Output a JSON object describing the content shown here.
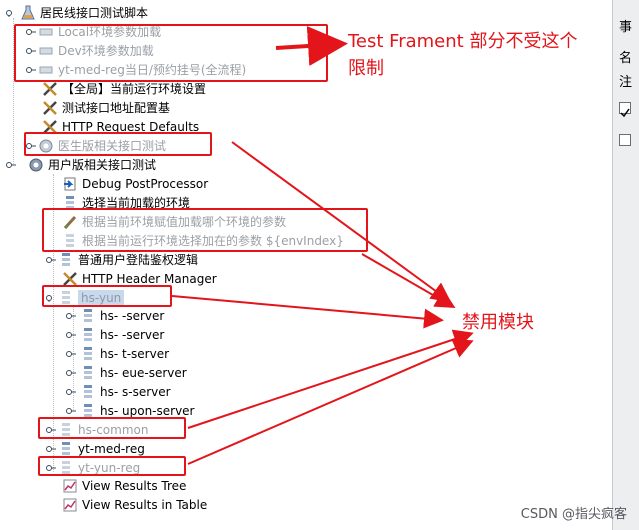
{
  "tree": {
    "root": "居民线接口测试脚本",
    "items": [
      {
        "key": "local",
        "label": "Local环境参数加载",
        "disabled": true
      },
      {
        "key": "dev",
        "label": "Dev环境参数加载",
        "disabled": true
      },
      {
        "key": "ytmed_full",
        "label": "yt-med-reg当日/预约挂号(全流程)",
        "disabled": true
      },
      {
        "key": "global_env",
        "label": "【全局】当前运行环境设置",
        "disabled": false
      },
      {
        "key": "addr_config",
        "label": "测试接口地址配置基",
        "disabled": false
      },
      {
        "key": "http_defaults",
        "label": "HTTP Request Defaults",
        "disabled": false
      },
      {
        "key": "doctor",
        "label": "医生版相关接口测试",
        "disabled": true
      },
      {
        "key": "user",
        "label": "用户版相关接口测试",
        "disabled": false
      },
      {
        "key": "debug_pp",
        "label": "Debug PostProcessor",
        "disabled": false
      },
      {
        "key": "select_env",
        "label": "选择当前加载的环境",
        "disabled": false
      },
      {
        "key": "env_assign",
        "label": "根据当前环境赋值加载哪个环境的参数",
        "disabled": true
      },
      {
        "key": "env_select",
        "label": "根据当前运行环境选择加在的参数 ${envIndex}",
        "disabled": true
      },
      {
        "key": "login_auth",
        "label": "普通用户登陆鉴权逻辑",
        "disabled": false
      },
      {
        "key": "header_mgr",
        "label": "HTTP Header Manager",
        "disabled": false
      },
      {
        "key": "hsyun",
        "label": "hs-yun",
        "disabled": true
      },
      {
        "key": "srv1",
        "label": "hs-        -server",
        "disabled": false
      },
      {
        "key": "srv2",
        "label": "hs-        -server",
        "disabled": false
      },
      {
        "key": "srv3",
        "label": "hs-        t-server",
        "disabled": false
      },
      {
        "key": "srv4",
        "label": "hs-        eue-server",
        "disabled": false
      },
      {
        "key": "srv5",
        "label": "hs-        s-server",
        "disabled": false
      },
      {
        "key": "srv6",
        "label": "hs-        upon-server",
        "disabled": false
      },
      {
        "key": "hscommon",
        "label": "hs-common",
        "disabled": true
      },
      {
        "key": "ytmedreg",
        "label": "yt-med-reg",
        "disabled": false
      },
      {
        "key": "ytyunreg",
        "label": "yt-yun-reg",
        "disabled": true
      },
      {
        "key": "vrt",
        "label": "View Results Tree",
        "disabled": false
      },
      {
        "key": "vrtable",
        "label": "View Results in Table",
        "disabled": false
      }
    ]
  },
  "annotations": {
    "test_fragment": "Test Frament 部分不受这个限制",
    "test_fragment_line1": "Test Frament 部分不受这个",
    "test_fragment_line2": "限制",
    "disabled_modules": "禁用模块",
    "color": "#e3151a"
  },
  "right_panel": {
    "label1": "事",
    "label2": "名",
    "label3": "注"
  },
  "watermark": "CSDN @指尖疯客"
}
